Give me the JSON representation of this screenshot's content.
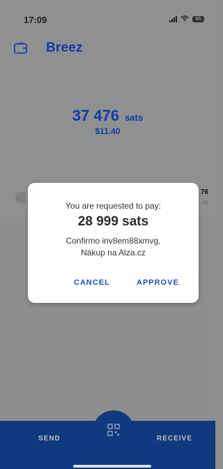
{
  "status_bar": {
    "time": "17:09",
    "battery": "65"
  },
  "header": {
    "logo_text": "Breez",
    "wallet_icon": "wallet-icon"
  },
  "balance": {
    "amount": "37 476",
    "unit": "sats",
    "fiat": "$11.40"
  },
  "background_list": {
    "partial_value": "76",
    "partial_sub": "00"
  },
  "dialog": {
    "prompt": "You are requested to pay:",
    "amount": "28 999 sats",
    "description_line1": "Confirmo inv8em88xmvg,",
    "description_line2": "Nákup na Alza.cz",
    "cancel_label": "CANCEL",
    "approve_label": "APPROVE"
  },
  "bottom_bar": {
    "send_label": "SEND",
    "receive_label": "RECEIVE",
    "scan_icon": "qr-scan-icon"
  },
  "colors": {
    "brand": "#0e3da8",
    "bottom_bar": "#0f3a7e",
    "dialog_action": "#1f4fa6"
  }
}
